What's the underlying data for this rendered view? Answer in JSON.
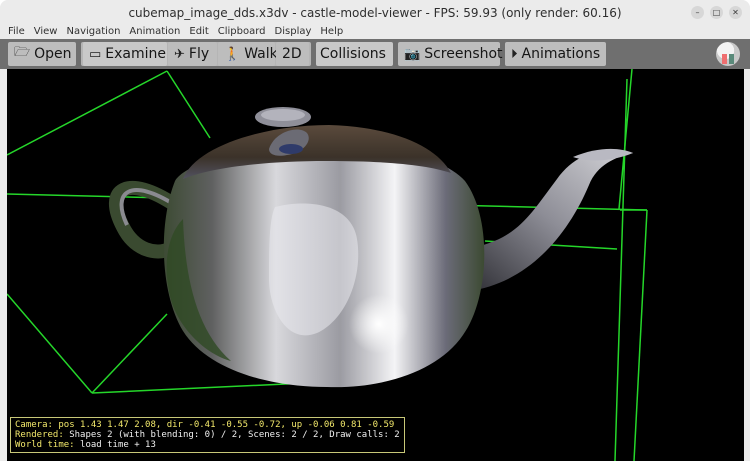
{
  "window": {
    "title": "cubemap_image_dds.x3dv - castle-model-viewer - FPS: 59.93 (only render: 60.16)",
    "controls": [
      "–",
      "□",
      "✕"
    ]
  },
  "menubar": [
    "File",
    "View",
    "Navigation",
    "Animation",
    "Edit",
    "Clipboard",
    "Display",
    "Help"
  ],
  "toolbar": {
    "open": "Open",
    "examine": "Examine",
    "fly": "Fly",
    "walk": "Walk",
    "two_d": "2D",
    "collisions": "Collisions",
    "screenshot": "Screenshot",
    "animations": "Animations"
  },
  "hud": {
    "camera_label": "Camera:",
    "camera_text": " pos 1.43 1.47 2.08, dir -0.41 -0.55 -0.72, up -0.06 0.81 -0.59",
    "rendered_label": "Rendered:",
    "rendered_text": " Shapes 2 (with blending: 0) / 2, Scenes: 2 / 2, Draw calls: 2",
    "world_label": "World time:",
    "world_text": " load time + 13"
  }
}
